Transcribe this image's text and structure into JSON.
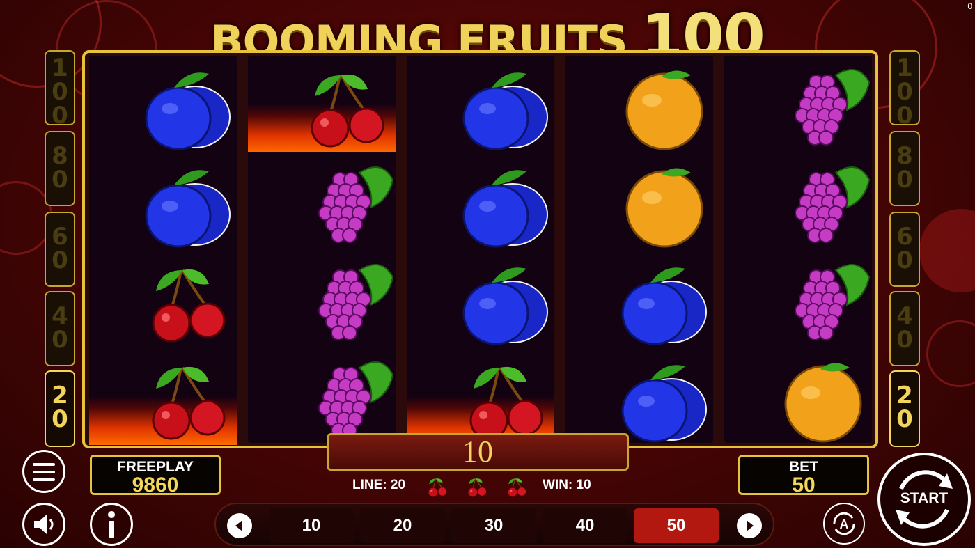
{
  "game": {
    "title_text": "BOOMING FRUITS",
    "title_number": "100",
    "corner_counter": "0"
  },
  "paylines": {
    "left": [
      "100",
      "80",
      "60",
      "40",
      "20"
    ],
    "right": [
      "100",
      "80",
      "60",
      "40",
      "20"
    ],
    "active": "20"
  },
  "reels": [
    {
      "symbols": [
        "plum",
        "plum",
        "cherry",
        "cherry"
      ],
      "burning": [
        3
      ]
    },
    {
      "symbols": [
        "cherry",
        "grapes",
        "grapes",
        "grapes"
      ],
      "burning": [
        0
      ]
    },
    {
      "symbols": [
        "plum",
        "plum",
        "plum",
        "cherry"
      ],
      "burning": [
        3
      ]
    },
    {
      "symbols": [
        "orange",
        "orange",
        "plum",
        "plum"
      ],
      "burning": []
    },
    {
      "symbols": [
        "grapes",
        "grapes",
        "grapes",
        "orange"
      ],
      "burning": []
    }
  ],
  "win_display": {
    "value": "10"
  },
  "freeplay": {
    "label": "FREEPLAY",
    "value": "9860"
  },
  "bet": {
    "label": "BET",
    "value": "50"
  },
  "line_info": {
    "line_text": "LINE: 20",
    "win_text": "WIN: 10",
    "win_symbol": "cherry",
    "win_symbol_count": 3
  },
  "bet_options": [
    "10",
    "20",
    "30",
    "40",
    "50"
  ],
  "selected_bet": "50",
  "buttons": {
    "start_label": "START",
    "menu_icon": "hamburger-menu-icon",
    "sound_icon": "speaker-icon",
    "info_icon": "info-icon",
    "autoplay_icon": "autoplay-icon",
    "prev_icon": "arrow-left-icon",
    "next_icon": "arrow-right-icon"
  },
  "colors": {
    "gold": "#e7c33b",
    "bet_selected": "#b21810",
    "background": "#4a0505"
  }
}
